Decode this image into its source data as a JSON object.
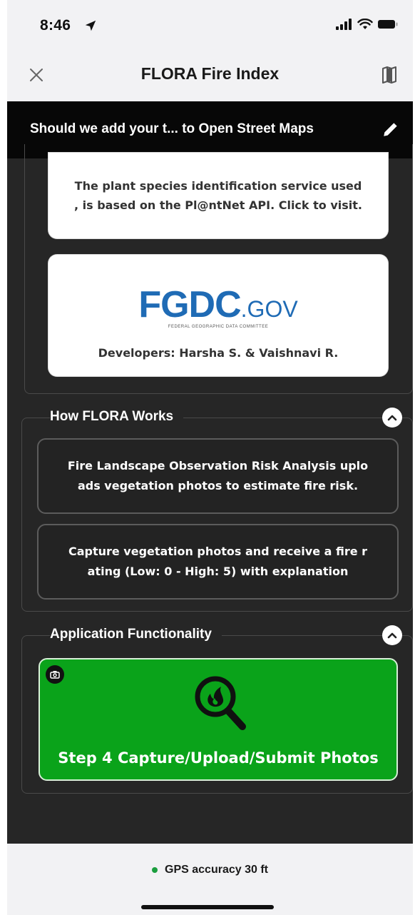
{
  "status_bar": {
    "time": "8:46"
  },
  "nav": {
    "title": "FLORA Fire Index",
    "close_icon": "close-icon",
    "map_icon": "map-icon"
  },
  "banner": {
    "text": "Should we add your t... to Open Street Maps",
    "edit_icon": "pencil-icon"
  },
  "about": {
    "plantnet_text_line1": "The plant species identification service used",
    "plantnet_text_line2": ", is based on the Pl@ntNet API. Click to visit.",
    "logo_main": "FGDC",
    "logo_suffix": ".GOV",
    "logo_subtitle": "FEDERAL GEOGRAPHIC DATA COMMITTEE",
    "developers": "Developers: Harsha S. & Vaishnavi R."
  },
  "how_flora_works": {
    "title": "How FLORA Works",
    "card1_line1": "Fire Landscape Observation Risk Analysis uplo",
    "card1_line2": "ads vegetation photos to estimate fire risk.",
    "card2_line1": "Capture vegetation photos and receive a fire r",
    "card2_line2": "ating (Low: 0 - High: 5) with explanation"
  },
  "app_functionality": {
    "title": "Application Functionality",
    "capture_button_label": "Step 4 Capture/Upload/Submit Photos"
  },
  "footer": {
    "gps_text": "GPS accuracy 30 ft"
  },
  "colors": {
    "accent_green": "#0aa31a",
    "fgdc_blue": "#1f6bb5",
    "gps_dot": "#1b9e3e",
    "content_bg": "#262626"
  }
}
